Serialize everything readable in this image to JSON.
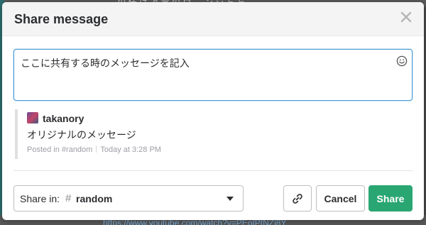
{
  "background": {
    "top_text": "… の 任 は 冱 常 の ウ … ン ジ ち ら …",
    "bottom_link": "https://www.youtube.com/watch?v=PEoIPtNZi8Y"
  },
  "dialog": {
    "title": "Share message",
    "close_icon": "close-icon"
  },
  "message": {
    "value": "ここに共有する時のメッセージを記入",
    "emoji_icon": "smiley-icon"
  },
  "quoted": {
    "author": "takanory",
    "text": "オリジナルのメッセージ",
    "posted_in": "Posted in #random",
    "timestamp": "Today at 3:28 PM"
  },
  "footer": {
    "share_in_label": "Share in:",
    "channel_prefix": "#",
    "channel": "random",
    "copy_link_icon": "link-icon",
    "cancel_label": "Cancel",
    "share_label": "Share"
  },
  "colors": {
    "accent_green": "#2aa672",
    "focus_blue": "#4c9bd6",
    "header_bg": "#f4f4f4"
  }
}
